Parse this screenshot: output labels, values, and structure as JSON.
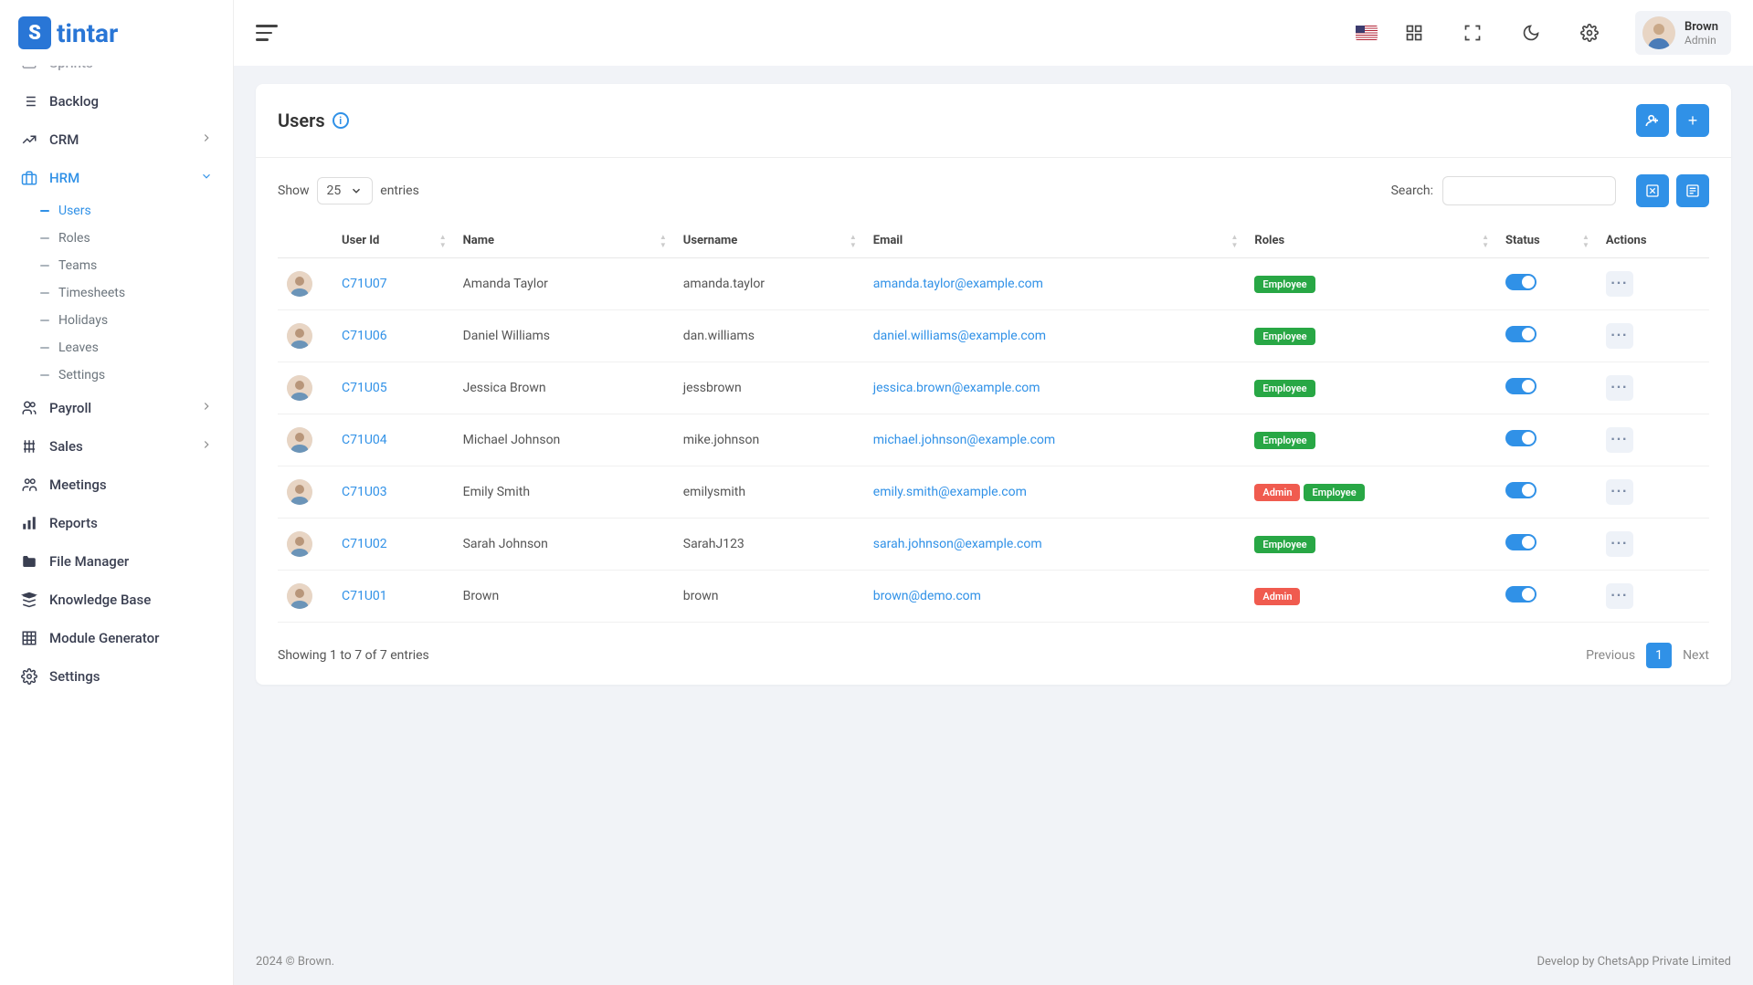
{
  "brand": "tintar",
  "topbar": {
    "user_name": "Brown",
    "user_role": "Admin"
  },
  "sidebar": {
    "items": [
      {
        "label": "Sprints",
        "icon": "sprint"
      },
      {
        "label": "Backlog",
        "icon": "backlog"
      },
      {
        "label": "CRM",
        "icon": "crm",
        "chev": true
      },
      {
        "label": "HRM",
        "icon": "hrm",
        "chev": true,
        "active": true
      },
      {
        "label": "Payroll",
        "icon": "payroll",
        "chev": true
      },
      {
        "label": "Sales",
        "icon": "sales",
        "chev": true
      },
      {
        "label": "Meetings",
        "icon": "meetings"
      },
      {
        "label": "Reports",
        "icon": "reports"
      },
      {
        "label": "File Manager",
        "icon": "folder"
      },
      {
        "label": "Knowledge Base",
        "icon": "kb"
      },
      {
        "label": "Module Generator",
        "icon": "grid"
      },
      {
        "label": "Settings",
        "icon": "gear"
      }
    ],
    "hrm_sub": [
      {
        "label": "Users",
        "active": true
      },
      {
        "label": "Roles"
      },
      {
        "label": "Teams"
      },
      {
        "label": "Timesheets"
      },
      {
        "label": "Holidays"
      },
      {
        "label": "Leaves"
      },
      {
        "label": "Settings"
      }
    ]
  },
  "page": {
    "title": "Users",
    "show_label": "Show",
    "entries_label": "entries",
    "per_page": "25",
    "search_label": "Search:",
    "columns": [
      "",
      "User Id",
      "Name",
      "Username",
      "Email",
      "Roles",
      "Status",
      "Actions"
    ],
    "rows": [
      {
        "id": "C71U07",
        "name": "Amanda Taylor",
        "username": "amanda.taylor",
        "email": "amanda.taylor@example.com",
        "roles": [
          "Employee"
        ],
        "status": true
      },
      {
        "id": "C71U06",
        "name": "Daniel Williams",
        "username": "dan.williams",
        "email": "daniel.williams@example.com",
        "roles": [
          "Employee"
        ],
        "status": true
      },
      {
        "id": "C71U05",
        "name": "Jessica Brown",
        "username": "jessbrown",
        "email": "jessica.brown@example.com",
        "roles": [
          "Employee"
        ],
        "status": true
      },
      {
        "id": "C71U04",
        "name": "Michael Johnson",
        "username": "mike.johnson",
        "email": "michael.johnson@example.com",
        "roles": [
          "Employee"
        ],
        "status": true
      },
      {
        "id": "C71U03",
        "name": "Emily Smith",
        "username": "emilysmith",
        "email": "emily.smith@example.com",
        "roles": [
          "Admin",
          "Employee"
        ],
        "status": true
      },
      {
        "id": "C71U02",
        "name": "Sarah Johnson",
        "username": "SarahJ123",
        "email": "sarah.johnson@example.com",
        "roles": [
          "Employee"
        ],
        "status": true
      },
      {
        "id": "C71U01",
        "name": "Brown",
        "username": "brown",
        "email": "brown@demo.com",
        "roles": [
          "Admin"
        ],
        "status": true
      }
    ],
    "info": "Showing 1 to 7 of 7 entries",
    "prev": "Previous",
    "next": "Next",
    "current_page": "1"
  },
  "footer": {
    "left": "2024 © Brown.",
    "right": "Develop by ChetsApp Private Limited"
  }
}
